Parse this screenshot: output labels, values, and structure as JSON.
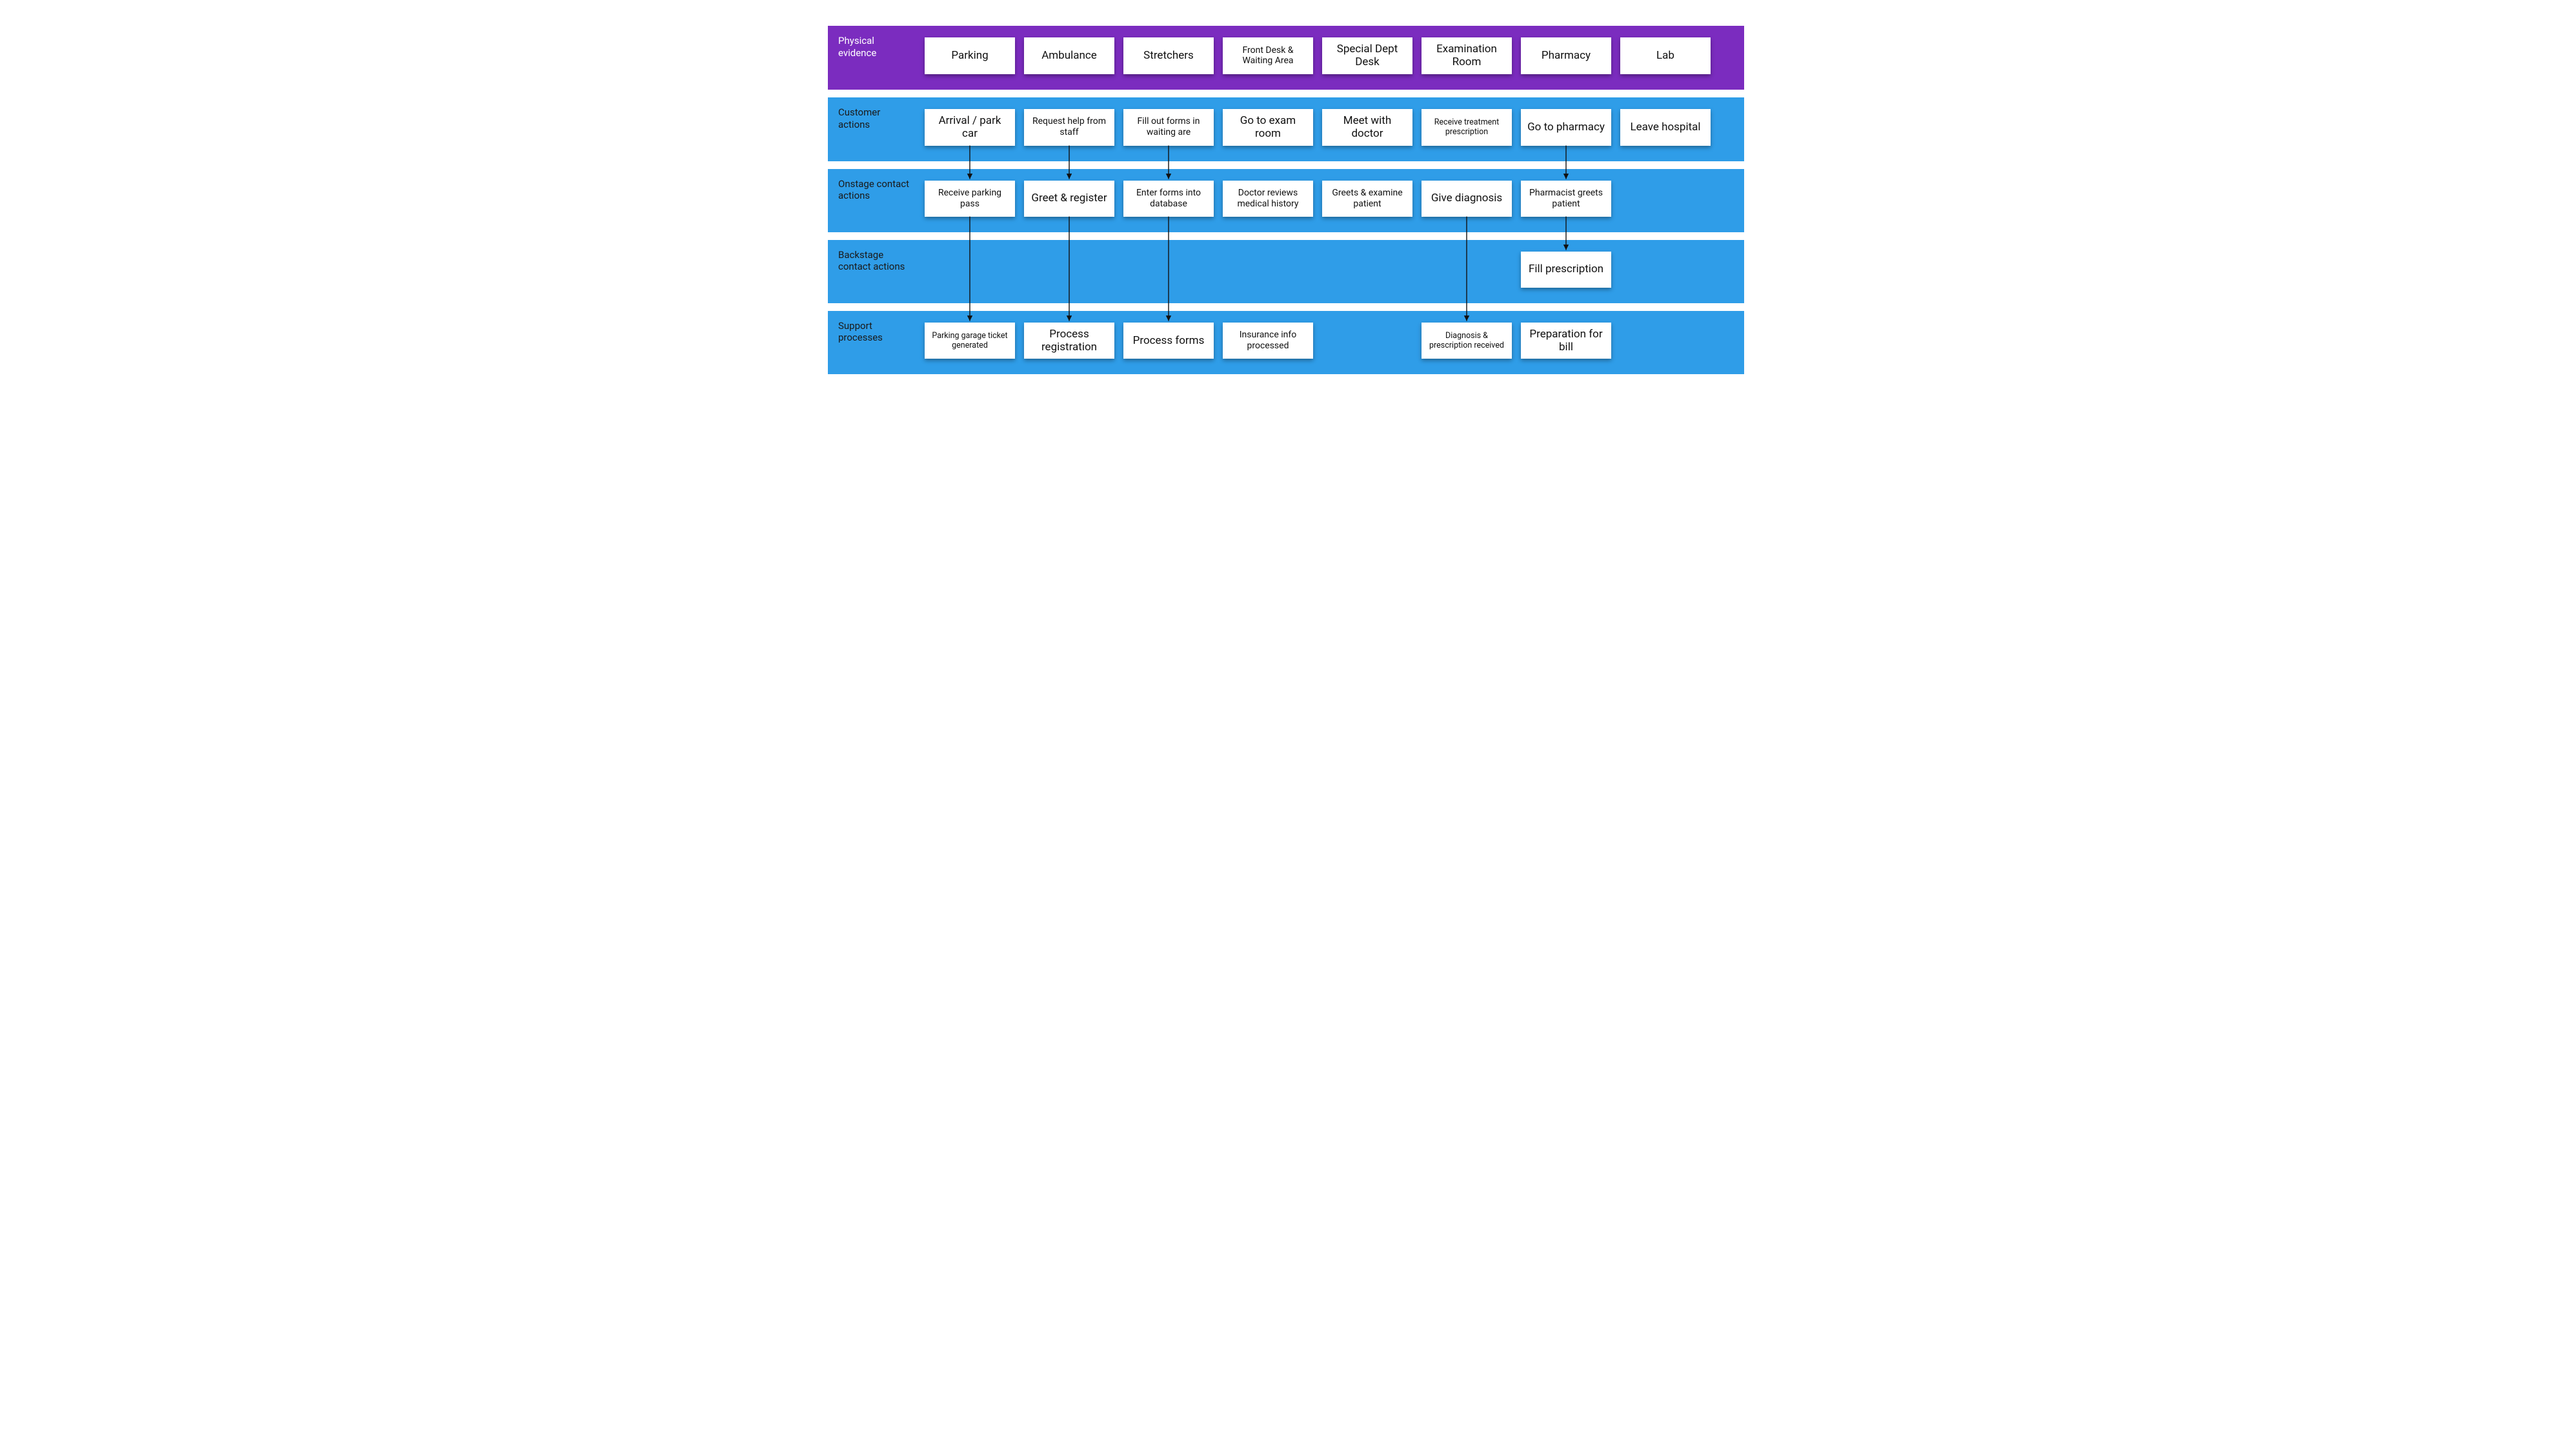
{
  "colors": {
    "purple": "#7b2cbf",
    "blue": "#2f9de8",
    "card_bg": "#ffffff",
    "text_dark": "#111111",
    "text_light": "#ffffff"
  },
  "lanes": {
    "physical_evidence": {
      "label": "Physical evidence",
      "cards": [
        "Parking",
        "Ambulance",
        "Stretchers",
        "Front Desk & Waiting Area",
        "Special Dept Desk",
        "Examination Room",
        "Pharmacy",
        "Lab"
      ]
    },
    "customer_actions": {
      "label": "Customer actions",
      "cards": [
        "Arrival / park car",
        "Request help from staff",
        "Fill out forms in waiting are",
        "Go to exam room",
        "Meet with doctor",
        "Receive treatment prescription",
        "Go to pharmacy",
        "Leave hospital"
      ]
    },
    "onstage": {
      "label": "Onstage contact actions",
      "cards": [
        "Receive parking pass",
        "Greet & register",
        "Enter forms into database",
        "Doctor reviews medical history",
        "Greets & examine patient",
        "Give diagnosis",
        "Pharmacist greets patient",
        ""
      ]
    },
    "backstage": {
      "label": "Backstage contact actions",
      "cards": [
        "",
        "",
        "",
        "",
        "",
        "",
        "Fill prescription",
        ""
      ]
    },
    "support": {
      "label": "Support processes",
      "cards": [
        "Parking garage ticket generated",
        "Process registration",
        "Process forms",
        "Insurance info processed",
        "",
        "Diagnosis & prescription received",
        "Preparation for bill",
        ""
      ]
    }
  },
  "arrows": [
    {
      "from": "customer_actions.0",
      "to": "onstage.0"
    },
    {
      "from": "customer_actions.1",
      "to": "onstage.1"
    },
    {
      "from": "customer_actions.2",
      "to": "onstage.2"
    },
    {
      "from": "customer_actions.6",
      "to": "onstage.6"
    },
    {
      "from": "onstage.0",
      "to": "support.0"
    },
    {
      "from": "onstage.1",
      "to": "support.1"
    },
    {
      "from": "onstage.2",
      "to": "support.2"
    },
    {
      "from": "onstage.5",
      "to": "support.5"
    },
    {
      "from": "onstage.6",
      "to": "backstage.6"
    }
  ]
}
